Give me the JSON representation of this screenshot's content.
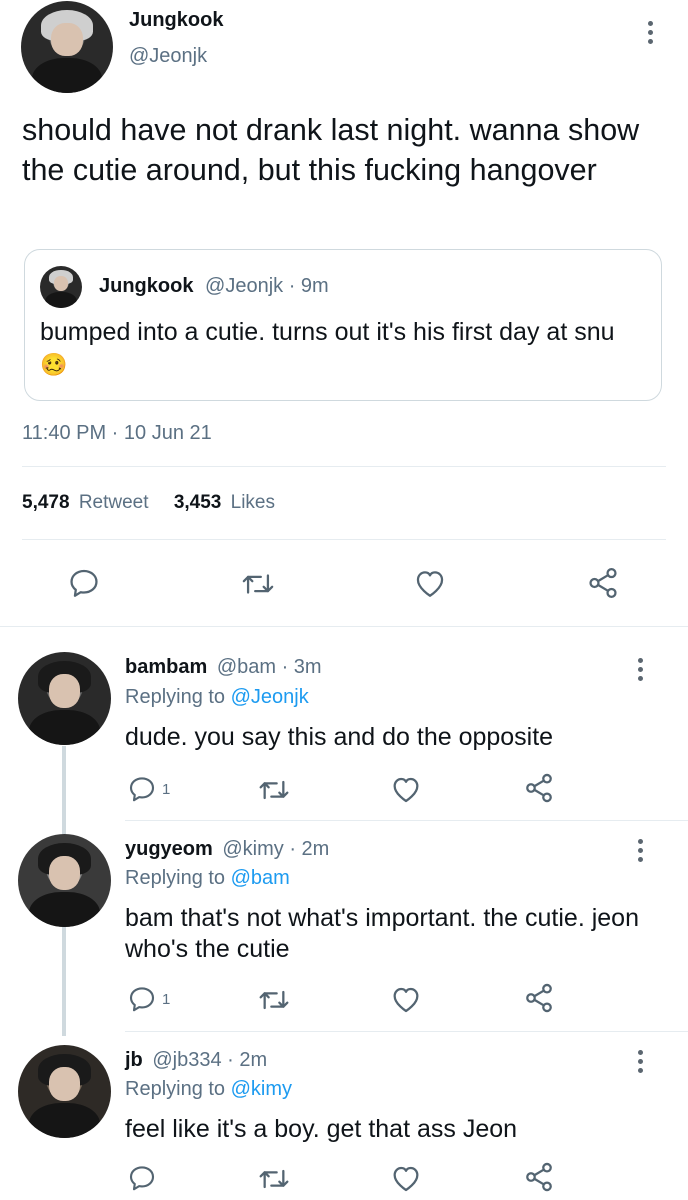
{
  "tweet": {
    "author_name": "Jungkook",
    "author_handle": "@Jeonjk",
    "text": "should have not drank last night. wanna show the cutie around, but this fucking hangover",
    "quote": {
      "author_name": "Jungkook",
      "handle_time": "@Jeonjk · 9m",
      "text": "bumped into a cutie. turns out it's his first day at snu",
      "emoji": "🥴"
    },
    "timestamp": "11:40 PM · 10 Jun 21",
    "retweets_count": "5,478",
    "retweets_label": "Retweet",
    "likes_count": "3,453",
    "likes_label": "Likes"
  },
  "replies": [
    {
      "name": "bambam",
      "handle_time": "@bam · 3m",
      "replying_prefix": "Replying to",
      "replying_to": "@Jeonjk",
      "text": "dude. you say this and do the opposite",
      "reply_count": "1"
    },
    {
      "name": "yugyeom",
      "handle_time": "@kimy · 2m",
      "replying_prefix": "Replying to",
      "replying_to": "@bam",
      "text": "bam that's not what's important. the cutie. jeon who's the cutie",
      "reply_count": "1"
    },
    {
      "name": "jb",
      "handle_time": "@jb334 · 2m",
      "replying_prefix": "Replying to",
      "replying_to": "@kimy",
      "text": "feel like it's a boy. get that ass Jeon",
      "reply_count": ""
    }
  ],
  "icons": {
    "reply": "reply-icon",
    "retweet": "retweet-icon",
    "like": "heart-icon",
    "share": "share-icon",
    "more": "more-icon"
  },
  "colors": {
    "link": "#1d9bf0",
    "muted": "#5b7083",
    "text": "#0f1419",
    "divider": "#e6ecf0"
  }
}
